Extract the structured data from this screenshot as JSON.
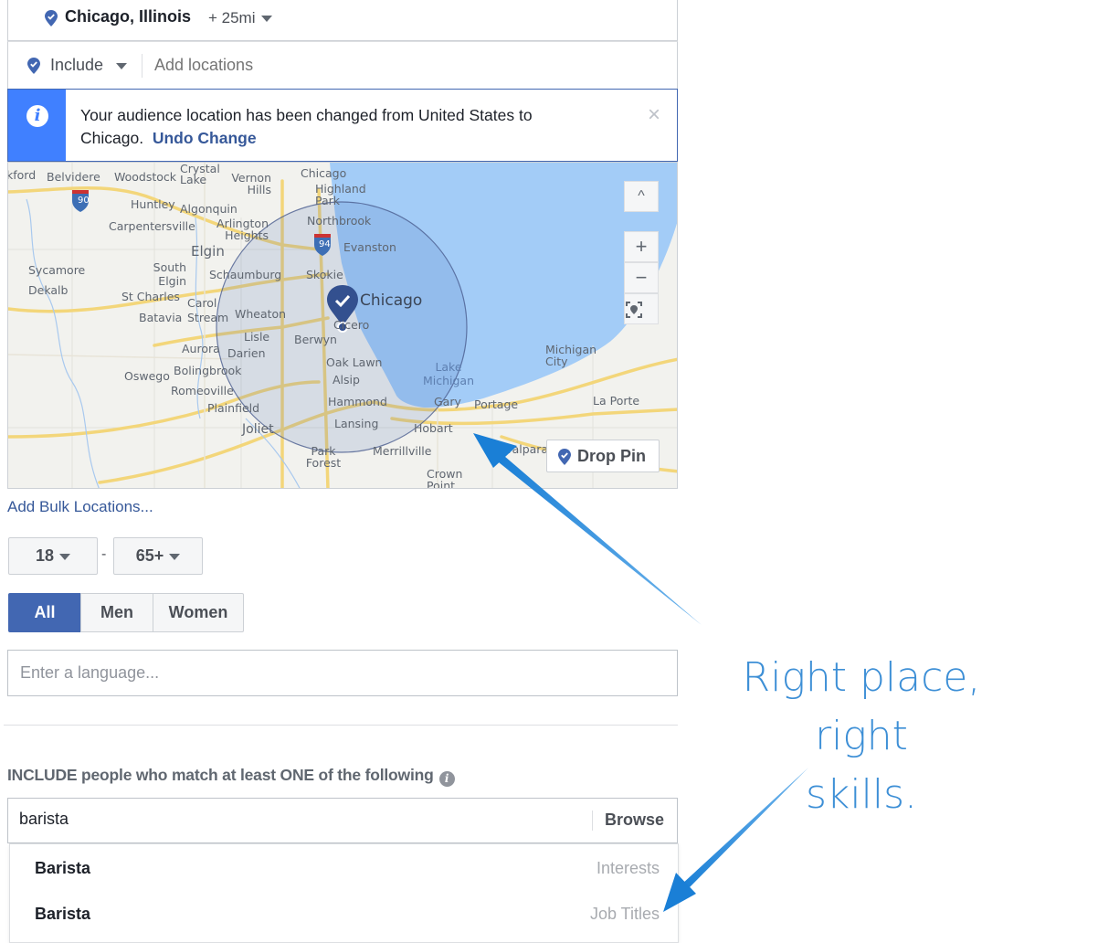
{
  "location": {
    "selected_name": "Chicago, Illinois",
    "radius": "+ 25mi",
    "include_mode": "Include",
    "add_placeholder": "Add locations"
  },
  "notice": {
    "text": "Your audience location has been changed from United States to Chicago.",
    "undo_label": "Undo Change",
    "close_glyph": "×"
  },
  "map": {
    "cities": [
      "kford",
      "Belvidere",
      "Woodstock",
      "Crystal Lake",
      "Vernon Hills",
      "Chicago",
      "Highland Park",
      "Huntley",
      "Algonquin",
      "Carpentersville",
      "Arlington Heights",
      "Northbrook",
      "Evanston",
      "Elgin",
      "Sycamore",
      "South Elgin",
      "Schaumburg",
      "Skokie",
      "Dekalb",
      "St Charles",
      "Carol Stream",
      "Batavia",
      "Wheaton",
      "Cicero",
      "Lisle",
      "Berwyn",
      "Aurora",
      "Darien",
      "Oak Lawn",
      "Oswego",
      "Bolingbrook",
      "Alsip",
      "Romeoville",
      "Plainfield",
      "Hammond",
      "Gary",
      "Portage",
      "Lansing",
      "Hobart",
      "Joliet",
      "Park Forest",
      "Merrillville",
      "Crown Point",
      "Valparai",
      "Michigan City",
      "La Porte",
      "Lake Michigan"
    ],
    "pin_label": "Chicago",
    "highway_shields": [
      "90",
      "94"
    ],
    "controls": {
      "collapse": "^",
      "zoom_in": "+",
      "zoom_out": "−"
    },
    "drop_pin_label": "Drop Pin",
    "radius_fill": "#4267b2",
    "water_color": "#a3ccf7"
  },
  "bulk_link": "Add Bulk Locations...",
  "age": {
    "min": "18",
    "separator": "-",
    "max": "65+"
  },
  "gender": {
    "options": [
      "All",
      "Men",
      "Women"
    ],
    "selected": "All"
  },
  "language": {
    "placeholder": "Enter a language..."
  },
  "targeting": {
    "heading": "INCLUDE people who match at least ONE of the following",
    "search_value": "barista",
    "browse_label": "Browse",
    "suggestions": [
      {
        "name": "Barista",
        "type": "Interests"
      },
      {
        "name": "Barista",
        "type": "Job Titles"
      }
    ]
  },
  "annotation": {
    "text_line1": "Right place, right",
    "text_line2": "skills.",
    "color": "#3d8fd6"
  },
  "colors": {
    "brand": "#4267b2",
    "info_bar": "#4080ff",
    "link": "#365899"
  }
}
